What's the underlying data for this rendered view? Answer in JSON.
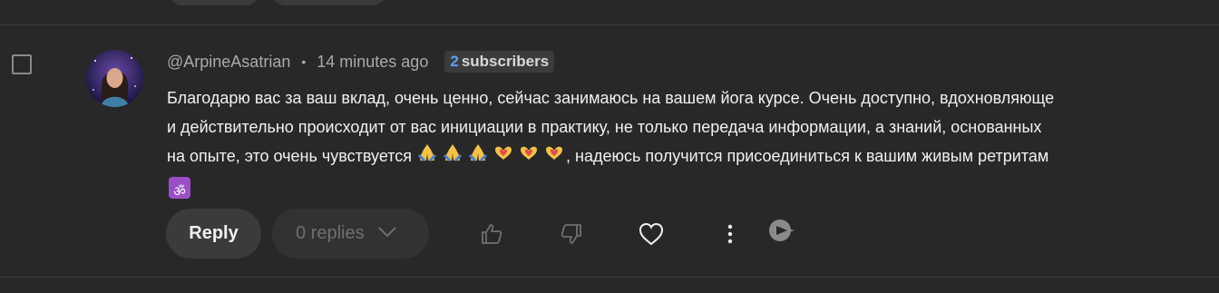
{
  "comment": {
    "author": "@ArpineAsatrian",
    "separator": "•",
    "time": "14 minutes ago",
    "subscribers": {
      "count": "2",
      "label": "subscribers"
    },
    "text": {
      "line1": "Благодарю вас за ваш вклад, очень ценно, сейчас занимаюсь на вашем йога курсе. Очень доступно, вдохновляюще",
      "line2": "и действительно происходит от вас инициации в практику, не только передача информации, а знаний, основанных",
      "line3_before": "на опыте, это очень чувствуется",
      "line3_after": ", надеюсь получится присоединиться к вашим живым ретритам",
      "emojis": [
        "🙏",
        "🙏",
        "🙏",
        "🫶",
        "🫶",
        "🫶"
      ],
      "om": "ॐ"
    }
  },
  "actions": {
    "reply_label": "Reply",
    "replies_label": "0 replies"
  },
  "icons": [
    "checkbox",
    "avatar",
    "thumbs-up-icon",
    "thumbs-down-icon",
    "heart-icon",
    "more-vert-icon",
    "extension-icon"
  ],
  "colors": {
    "background": "#282828",
    "subscriber_count": "#5aa3f5",
    "om_box": "#9a4fc7"
  }
}
